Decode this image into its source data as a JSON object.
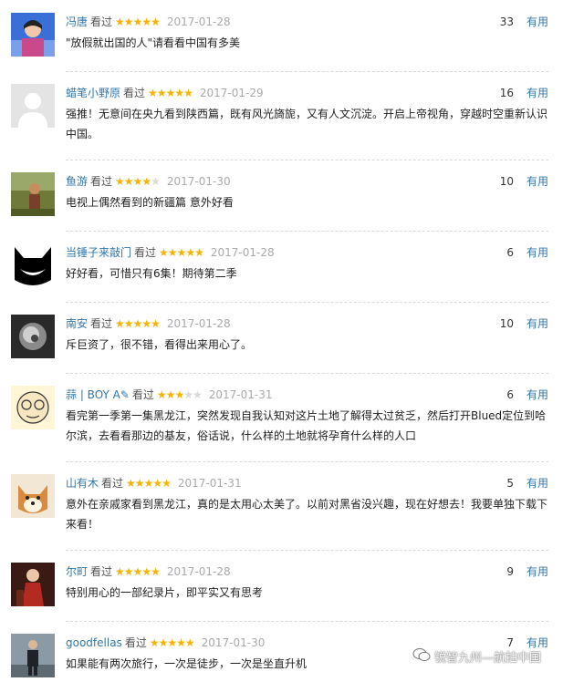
{
  "colors": {
    "username": "#3377aa",
    "star_on": "#f4b400",
    "star_off": "#d9d9d9",
    "date": "#aaaaaa",
    "useful": "#3377aa"
  },
  "reviews": [
    {
      "user": "冯唐",
      "watched": "看过",
      "rating": 5,
      "date": "2017-01-28",
      "votes": "33",
      "useful": "有用",
      "text": "\"放假就出国的人\"请看看中国有多美",
      "avatar": "person-portrait-avatar"
    },
    {
      "user": "蜡笔小野原",
      "watched": "看过",
      "rating": 5,
      "date": "2017-01-29",
      "votes": "16",
      "useful": "有用",
      "text": "强推！无意间在央九看到陕西篇，既有风光旖旎，又有人文沉淀。开启上帝视角，穿越时空重新认识中国。",
      "avatar": "default-user-avatar"
    },
    {
      "user": "鱼游",
      "watched": "看过",
      "rating": 4,
      "date": "2017-01-30",
      "votes": "10",
      "useful": "有用",
      "text": "电视上偶然看到的新疆篇 意外好看",
      "avatar": "nature-photo-avatar"
    },
    {
      "user": "当锤子来敲门",
      "watched": "看过",
      "rating": 5,
      "date": "2017-01-28",
      "votes": "6",
      "useful": "有用",
      "text": "好好看，可惜只有6集！期待第二季",
      "avatar": "cat-grin-avatar"
    },
    {
      "user": "南安",
      "watched": "看过",
      "rating": 5,
      "date": "2017-01-28",
      "votes": "10",
      "useful": "有用",
      "text": "斥巨资了，很不错，看得出来用心了。",
      "avatar": "dark-abstract-avatar"
    },
    {
      "user": "蒜 | BOY A✎",
      "watched": "看过",
      "rating": 3,
      "date": "2017-01-31",
      "votes": "6",
      "useful": "有用",
      "text": "看完第一季第一集黑龙江，突然发现自我认知对这片土地了解得太过贫乏，然后打开Blued定位到哈尔滨，去看看那边的基友，俗话说，什么样的土地就将孕育什么样的人口",
      "avatar": "cartoon-glasses-avatar"
    },
    {
      "user": "山有木",
      "watched": "看过",
      "rating": 5,
      "date": "2017-01-31",
      "votes": "5",
      "useful": "有用",
      "text": "意外在亲戚家看到黑龙江，真的是太用心太美了。以前对黑省没兴趣，现在好想去！我要单独下载下来看！",
      "avatar": "shiba-dog-avatar"
    },
    {
      "user": "尔町",
      "watched": "看过",
      "rating": 5,
      "date": "2017-01-28",
      "votes": "9",
      "useful": "有用",
      "text": "特别用心的一部纪录片，即平实又有思考",
      "avatar": "red-figure-avatar"
    },
    {
      "user": "goodfellas",
      "watched": "看过",
      "rating": 5,
      "date": "2017-01-30",
      "votes": "7",
      "useful": "有用",
      "text": "如果能有两次旅行，一次是徒步，一次是坐直升机",
      "avatar": "standing-man-avatar"
    }
  ],
  "watermark": {
    "text": "锐智九州—航拍中国",
    "icon": "wechat-icon"
  }
}
